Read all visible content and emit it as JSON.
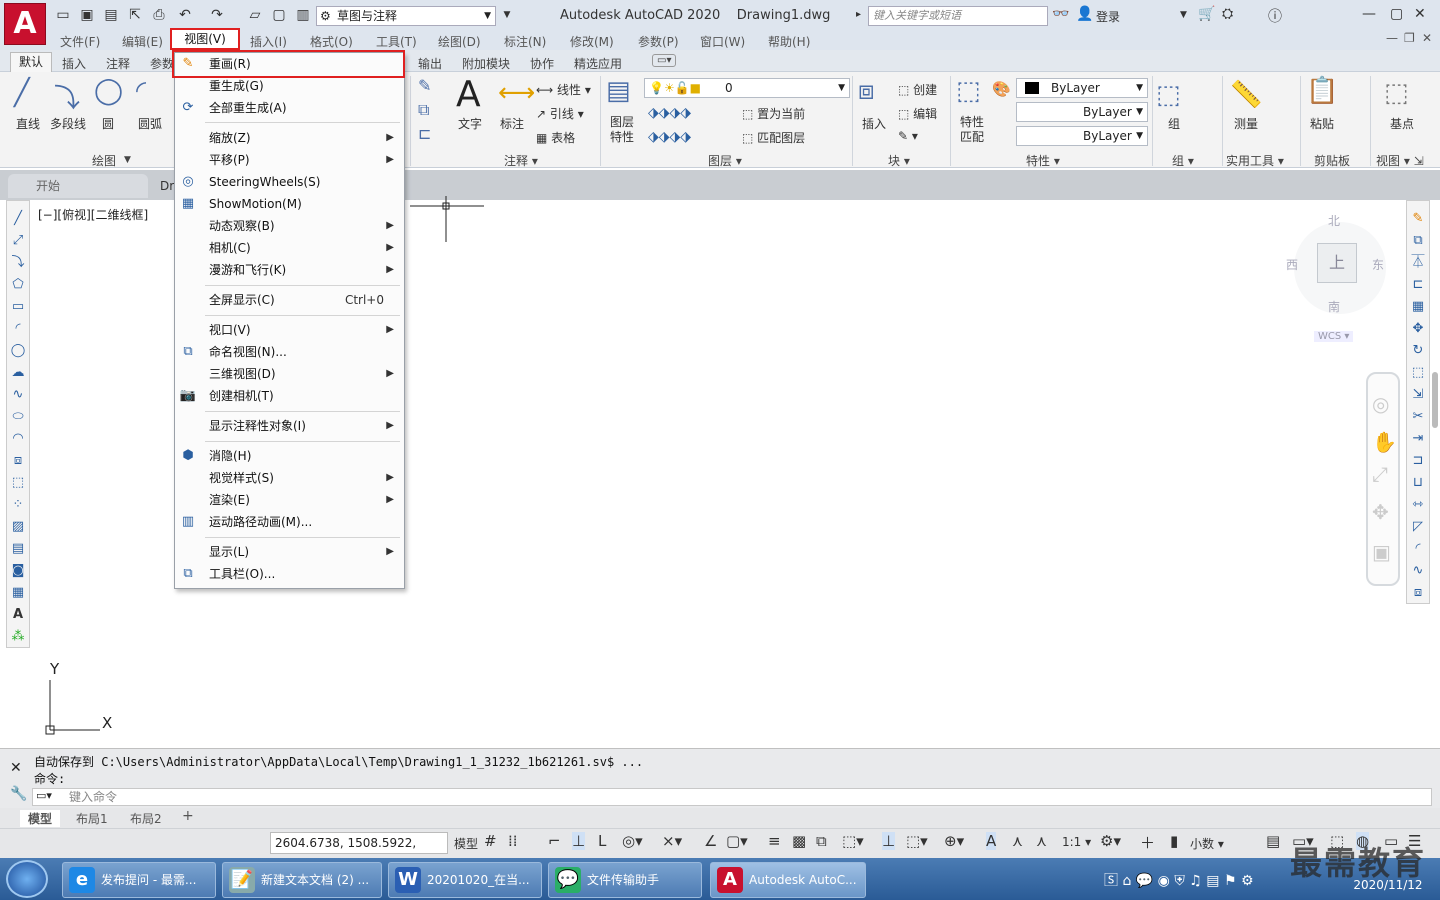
{
  "app": {
    "title": "Autodesk AutoCAD 2020",
    "document": "Drawing1.dwg",
    "logo_letter": "A",
    "workspace": "草图与注释",
    "search_placeholder": "键入关键字或短语",
    "login": "登录"
  },
  "menubar": [
    "文件(F)",
    "编辑(E)",
    "视图(V)",
    "插入(I)",
    "格式(O)",
    "工具(T)",
    "绘图(D)",
    "标注(N)",
    "修改(M)",
    "参数(P)",
    "窗口(W)",
    "帮助(H)"
  ],
  "ribbon_tabs": [
    "默认",
    "插入",
    "注释",
    "参数",
    "输出",
    "附加模块",
    "协作",
    "精选应用"
  ],
  "ribbon": {
    "draw": {
      "line": "直线",
      "polyline": "多段线",
      "circle": "圆",
      "arc": "圆弧",
      "title": "绘图"
    },
    "annotation": {
      "text": "文字",
      "dim": "标注",
      "linear": "线性",
      "leader": "引线",
      "table": "表格",
      "title": "注释"
    },
    "layers": {
      "props": "图层\n特性",
      "current_layer": "0",
      "set_current": "置为当前",
      "match_layer": "匹配图层",
      "title": "图层"
    },
    "block": {
      "insert": "插入",
      "create": "创建",
      "edit": "编辑",
      "title": "块"
    },
    "properties": {
      "match": "特性\n匹配",
      "color": "ByLayer",
      "linetype": "ByLayer",
      "lineweight": "ByLayer",
      "title": "特性"
    },
    "groups": {
      "group": "组",
      "title": "组"
    },
    "utilities": {
      "measure": "测量",
      "title": "实用工具"
    },
    "clipboard": {
      "paste": "粘贴",
      "title": "剪贴板"
    },
    "view": {
      "base": "基点",
      "title": "视图"
    }
  },
  "file_tabs": {
    "start": "开始",
    "drawing": "Dr"
  },
  "viewport_label": "[−][俯视][二维线框]",
  "viewcube": {
    "north": "北",
    "south": "南",
    "east": "东",
    "west": "西",
    "top": "上",
    "wcs": "WCS"
  },
  "ucs": {
    "y": "Y",
    "x": "X"
  },
  "view_menu": {
    "items": [
      {
        "label": "重画(R)",
        "submenu": false,
        "icon": "redraw-icon"
      },
      {
        "label": "重生成(G)",
        "submenu": false,
        "icon": ""
      },
      {
        "label": "全部重生成(A)",
        "submenu": false,
        "icon": "regen-all-icon"
      },
      {
        "label": "缩放(Z)",
        "submenu": true,
        "icon": ""
      },
      {
        "label": "平移(P)",
        "submenu": true,
        "icon": ""
      },
      {
        "label": "SteeringWheels(S)",
        "submenu": false,
        "icon": "steering-wheel-icon"
      },
      {
        "label": "ShowMotion(M)",
        "submenu": false,
        "icon": "showmotion-icon"
      },
      {
        "label": "动态观察(B)",
        "submenu": true,
        "icon": ""
      },
      {
        "label": "相机(C)",
        "submenu": true,
        "icon": ""
      },
      {
        "label": "漫游和飞行(K)",
        "submenu": true,
        "icon": ""
      },
      {
        "label": "全屏显示(C)",
        "shortcut": "Ctrl+0",
        "submenu": false,
        "icon": ""
      },
      {
        "label": "视口(V)",
        "submenu": true,
        "icon": ""
      },
      {
        "label": "命名视图(N)...",
        "submenu": false,
        "icon": "named-views-icon"
      },
      {
        "label": "三维视图(D)",
        "submenu": true,
        "icon": ""
      },
      {
        "label": "创建相机(T)",
        "submenu": false,
        "icon": "camera-icon"
      },
      {
        "label": "显示注释性对象(I)",
        "submenu": true,
        "icon": ""
      },
      {
        "label": "消隐(H)",
        "submenu": false,
        "icon": "hide-icon"
      },
      {
        "label": "视觉样式(S)",
        "submenu": true,
        "icon": ""
      },
      {
        "label": "渲染(E)",
        "submenu": true,
        "icon": ""
      },
      {
        "label": "运动路径动画(M)...",
        "submenu": false,
        "icon": "motion-path-icon"
      },
      {
        "label": "显示(L)",
        "submenu": true,
        "icon": ""
      },
      {
        "label": "工具栏(O)...",
        "submenu": false,
        "icon": "toolbars-icon"
      }
    ]
  },
  "command": {
    "history_line1": "自动保存到 C:\\Users\\Administrator\\AppData\\Local\\Temp\\Drawing1_1_31232_1b621261.sv$ ...",
    "history_line2": "命令:",
    "input_placeholder": "键入命令"
  },
  "layout_tabs": [
    "模型",
    "布局1",
    "布局2"
  ],
  "status": {
    "coords": "2604.6738, 1508.5922, 0.0000",
    "model": "模型",
    "scale": "1:1",
    "units": "小数"
  },
  "taskbar": {
    "items": [
      {
        "label": "发布提问 - 最需...",
        "icon": "e"
      },
      {
        "label": "新建文本文档 (2) ...",
        "icon": "📝"
      },
      {
        "label": "20201020_在当...",
        "icon": "W"
      },
      {
        "label": "文件传输助手",
        "icon": "💬"
      },
      {
        "label": "Autodesk AutoC...",
        "icon": "A"
      }
    ],
    "date": "2020/11/12"
  },
  "watermark": "最需教育",
  "colors": {
    "accent": "#e02020",
    "title_bg": "#dee5ee",
    "taskbar": "#2a5b96"
  }
}
